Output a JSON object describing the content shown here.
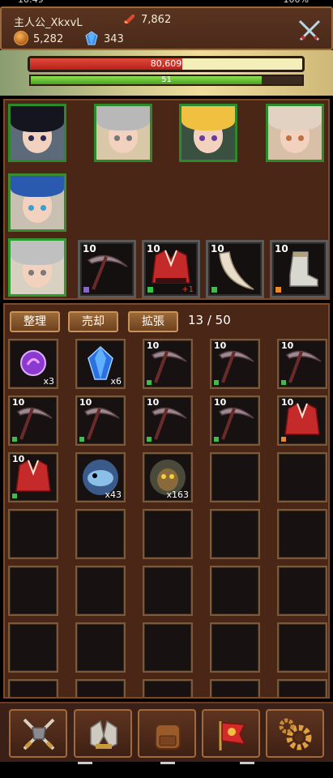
{
  "player": {
    "name": "主人公_XkxvL",
    "power": "7,862",
    "coins": "5,282",
    "gems": "343"
  },
  "hero": {
    "hp_text": "80,609",
    "hp_fraction": 0.56,
    "xp_text": "51",
    "xp_fraction": 0.85
  },
  "party": {
    "portraits": [
      {
        "name": "dark-haired-male-hero"
      },
      {
        "name": "silver-haired-girl"
      },
      {
        "name": "blonde-girl"
      },
      {
        "name": "fox-eared-girl"
      },
      {
        "name": "masked-blue-haired-girl"
      }
    ],
    "equipment": [
      {
        "level": "10",
        "item": "pickaxe",
        "rarity_color": "#8a63d2"
      },
      {
        "level": "10",
        "item": "red-armor",
        "rarity_color": "#3bbf4a",
        "plus": "+1"
      },
      {
        "level": "10",
        "item": "horn",
        "rarity_color": "#3bbf4a"
      },
      {
        "level": "10",
        "item": "boots",
        "rarity_color": "#e88a2a"
      }
    ]
  },
  "inventory": {
    "buttons": [
      "整理",
      "売却",
      "拡張"
    ],
    "count": "13 / 50",
    "items": [
      {
        "icon": "purple-orb",
        "qty": "x3"
      },
      {
        "icon": "blue-crystal",
        "qty": "x6"
      },
      {
        "icon": "pickaxe",
        "level": "10",
        "rarity_color": "#3bbf4a"
      },
      {
        "icon": "pickaxe",
        "level": "10",
        "rarity_color": "#3bbf4a"
      },
      {
        "icon": "pickaxe",
        "level": "10",
        "rarity_color": "#3bbf4a"
      },
      {
        "icon": "pickaxe",
        "level": "10",
        "rarity_color": "#3bbf4a"
      },
      {
        "icon": "pickaxe",
        "level": "10",
        "rarity_color": "#3bbf4a"
      },
      {
        "icon": "pickaxe",
        "level": "10",
        "rarity_color": "#3bbf4a"
      },
      {
        "icon": "pickaxe",
        "level": "10",
        "rarity_color": "#3bbf4a"
      },
      {
        "icon": "red-armor",
        "level": "10",
        "rarity_color": "#e88a2a"
      },
      {
        "icon": "red-armor",
        "level": "10",
        "rarity_color": "#3bbf4a"
      },
      {
        "icon": "blue-fish-monster",
        "qty": "x43"
      },
      {
        "icon": "goblin-head",
        "qty": "x163"
      }
    ]
  },
  "nav": [
    "battle-icon",
    "equipment-gauntlet-icon",
    "bag-icon",
    "flag-icon",
    "settings-gear-icon"
  ]
}
